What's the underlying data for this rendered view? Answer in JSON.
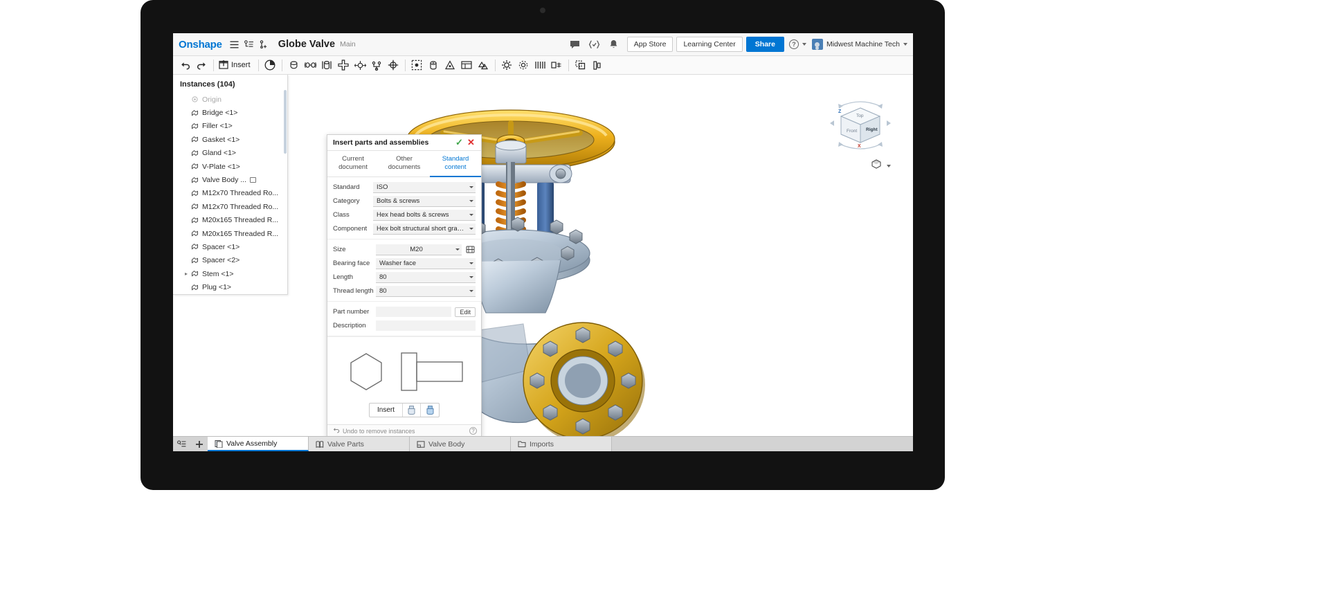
{
  "app": {
    "logo": "Onshape",
    "document_title": "Globe Valve",
    "branch": "Main",
    "icons": {
      "menu": "hamburger-menu-icon",
      "version_graph": "version-graph-icon",
      "add_version": "add-version-icon",
      "comments": "comment-icon",
      "checks": "code-checks-icon",
      "notifications": "bell-icon",
      "help": "help-icon",
      "avatar": "user-avatar"
    },
    "header_buttons": {
      "app_store": "App Store",
      "learning_center": "Learning Center",
      "share": "Share"
    },
    "user": "Midwest Machine Tech"
  },
  "toolbar": {
    "undo": "undo-icon",
    "redo": "redo-icon",
    "insert_label": "Insert",
    "tools": [
      "assemble-icon",
      "revolute-mate-icon",
      "slider-mate-icon",
      "cylindrical-mate-icon",
      "planar-mate-icon",
      "ball-mate-icon",
      "parallel-mate-icon",
      "tangent-mate-icon",
      "pin-slot-mate-icon",
      "fastened-mate-icon",
      "mate-connector-icon",
      "group-icon",
      "replicate-icon",
      "mate-features-icon",
      "gear-mate-icon",
      "linear-pattern-icon",
      "circular-pattern-icon",
      "transform-icon",
      "explode-icon"
    ]
  },
  "instances_panel": {
    "title": "Instances (104)",
    "items": [
      {
        "label": "Origin",
        "icon": "origin-icon",
        "dim": true,
        "expandable": false,
        "badge": false
      },
      {
        "label": "Bridge <1>",
        "icon": "part-icon",
        "dim": false,
        "expandable": false,
        "badge": false
      },
      {
        "label": "Filler <1>",
        "icon": "part-icon",
        "dim": false,
        "expandable": false,
        "badge": false
      },
      {
        "label": "Gasket <1>",
        "icon": "part-icon",
        "dim": false,
        "expandable": false,
        "badge": false
      },
      {
        "label": "Gland <1>",
        "icon": "part-icon",
        "dim": false,
        "expandable": false,
        "badge": false
      },
      {
        "label": "V-Plate <1>",
        "icon": "part-icon",
        "dim": false,
        "expandable": false,
        "badge": false
      },
      {
        "label": "Valve Body ...",
        "icon": "part-icon",
        "dim": false,
        "expandable": false,
        "badge": true
      },
      {
        "label": "M12x70 Threaded Ro...",
        "icon": "part-icon",
        "dim": false,
        "expandable": false,
        "badge": false
      },
      {
        "label": "M12x70 Threaded Ro...",
        "icon": "part-icon",
        "dim": false,
        "expandable": false,
        "badge": false
      },
      {
        "label": "M20x165 Threaded R...",
        "icon": "part-icon",
        "dim": false,
        "expandable": false,
        "badge": false
      },
      {
        "label": "M20x165 Threaded R...",
        "icon": "part-icon",
        "dim": false,
        "expandable": false,
        "badge": false
      },
      {
        "label": "Spacer <1>",
        "icon": "part-icon",
        "dim": false,
        "expandable": false,
        "badge": false
      },
      {
        "label": "Spacer <2>",
        "icon": "part-icon",
        "dim": false,
        "expandable": false,
        "badge": false
      },
      {
        "label": "Stem <1>",
        "icon": "part-icon",
        "dim": false,
        "expandable": true,
        "badge": false
      },
      {
        "label": "Plug <1>",
        "icon": "part-icon",
        "dim": false,
        "expandable": false,
        "badge": false
      }
    ]
  },
  "dialog": {
    "title": "Insert parts and assemblies",
    "accept_icon": "checkmark-icon",
    "close_icon": "close-icon",
    "tabs": [
      {
        "line1": "Current",
        "line2": "document",
        "active": false
      },
      {
        "line1": "Other",
        "line2": "documents",
        "active": false
      },
      {
        "line1": "Standard",
        "line2": "content",
        "active": true
      }
    ],
    "fields": [
      {
        "label": "Standard",
        "value": "ISO"
      },
      {
        "label": "Category",
        "value": "Bolts & screws"
      },
      {
        "label": "Class",
        "value": "Hex head bolts & screws"
      },
      {
        "label": "Component",
        "value": "Hex bolt structural short grade C ISO"
      }
    ],
    "spec_fields": [
      {
        "label": "Size",
        "value": "M20",
        "extra_icon": "configure-icon"
      },
      {
        "label": "Bearing face",
        "value": "Washer face",
        "extra_icon": null
      },
      {
        "label": "Length",
        "value": "80",
        "extra_icon": null
      },
      {
        "label": "Thread length",
        "value": "80",
        "extra_icon": null
      }
    ],
    "meta_fields": [
      {
        "label": "Part number",
        "value": "",
        "button": "Edit"
      },
      {
        "label": "Description",
        "value": "",
        "button": null
      }
    ],
    "preview": {
      "hex_head_icon": "hex-head-preview",
      "bolt_side_icon": "bolt-side-preview"
    },
    "insert_button": "Insert",
    "insert_icons": [
      "insert-part-icon",
      "insert-assembly-icon"
    ],
    "footer": {
      "undo_text": "Undo to remove instances",
      "help_icon": "help-icon"
    }
  },
  "viewport": {
    "view_cube": {
      "top_label": "Top",
      "front_label": "Front",
      "right_label": "Right",
      "axis_z": "Z",
      "axis_x": "X"
    },
    "display_mode_icon": "shaded-display-icon"
  },
  "bottom_tabs": {
    "controls": [
      "tab-list-icon",
      "add-tab-icon"
    ],
    "tabs": [
      {
        "label": "Valve Assembly",
        "icon": "assembly-icon",
        "active": true
      },
      {
        "label": "Valve Parts",
        "icon": "part-studio-icon",
        "active": false
      },
      {
        "label": "Valve Body",
        "icon": "drawing-icon",
        "active": false
      },
      {
        "label": "Imports",
        "icon": "folder-icon",
        "active": false
      }
    ]
  },
  "colors": {
    "brand": "#0176d3",
    "accept": "#3fa64a",
    "reject": "#e02f2f",
    "handwheel": "#e8a91d",
    "flange": "#d4a017",
    "body": "#b9c9d8",
    "bolt": "#8c96a0"
  }
}
